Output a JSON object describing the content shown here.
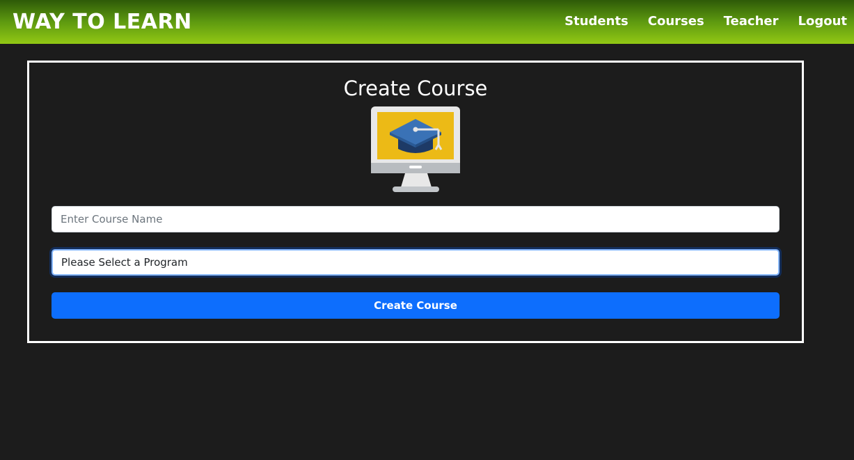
{
  "navbar": {
    "brand": "WAY TO LEARN",
    "links": [
      "Students",
      "Courses",
      "Teacher",
      "Logout"
    ],
    "gradient_top": "#2e5a08",
    "gradient_bottom": "#92c814"
  },
  "form": {
    "title": "Create Course",
    "illustration_icon": "computer-graduation-cap-icon",
    "course_name_placeholder": "Enter Course Name",
    "program_select_value": "Please Select a Program",
    "submit_label": "Create Course"
  },
  "colors": {
    "background": "#1c1c1c",
    "primary_button": "#0d6efd",
    "card_border": "#ffffff"
  }
}
